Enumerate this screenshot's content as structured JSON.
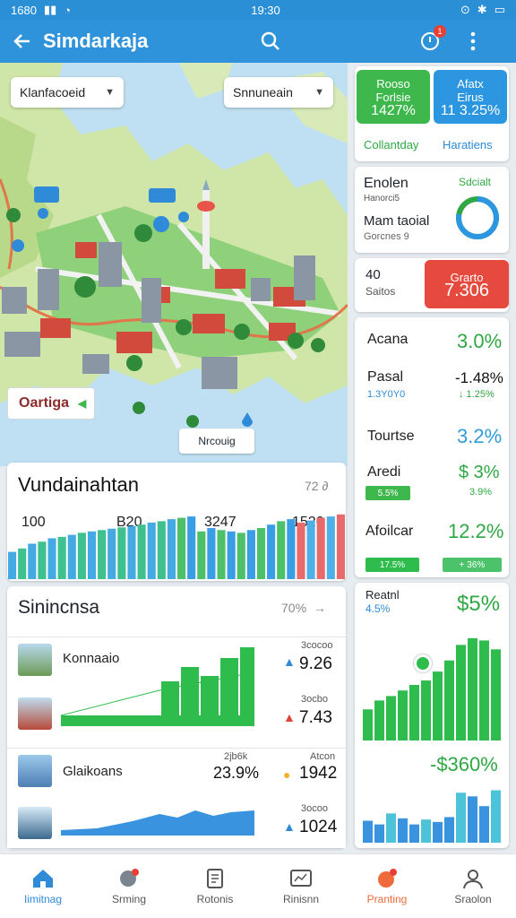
{
  "status": {
    "time_left": "1680",
    "time_center": "19:30"
  },
  "appbar": {
    "title": "Simdarkaja"
  },
  "map": {
    "dropdown_left": "Klanfacoeid",
    "dropdown_right": "Snnuneain",
    "callout_label": "Oartiga",
    "callout_bottom": "Nrcouig"
  },
  "stats": {
    "title": "Vundainahtan",
    "subtitle": "72 ∂",
    "numbers": [
      "100",
      "B20",
      "3247",
      "1520"
    ],
    "bars": [
      0.4,
      0.45,
      0.52,
      0.55,
      0.6,
      0.62,
      0.65,
      0.68,
      0.7,
      0.72,
      0.74,
      0.76,
      0.78,
      0.8,
      0.83,
      0.85,
      0.88,
      0.9,
      0.92,
      0.7,
      0.75,
      0.72,
      0.7,
      0.68,
      0.72,
      0.75,
      0.8,
      0.85,
      0.88,
      0.83,
      0.86,
      0.9,
      0.92,
      0.95
    ]
  },
  "list": {
    "title": "Sinincnsa",
    "subtitle": "70%",
    "rows": [
      {
        "label": "Konnaaio",
        "small": "3cocoo",
        "value": "9.26",
        "arrow": "up",
        "color": "#2f8bd8"
      },
      {
        "label": "",
        "small": "3ocbo",
        "value": "7.43",
        "arrow": "down",
        "color": "#e04436"
      },
      {
        "label": "Glaikoans",
        "small": "2jb6k",
        "value": "1942",
        "pct": "23.9%",
        "arrow": "dot",
        "color": "#f2b233"
      },
      {
        "label": "",
        "small": "3ocoo",
        "value": "1024",
        "arrow": "up",
        "color": "#2f8bd8"
      }
    ]
  },
  "side": {
    "tile1": {
      "l1": "Rooso",
      "l2": "Forlsie",
      "val": "1427%",
      "color": "#3eb84d"
    },
    "tile2": {
      "l1": "Afatx",
      "l2": "Eirus",
      "val": "11 3.25%",
      "color": "#2d96e0"
    },
    "tile1_caption": "Collantday",
    "tile2_caption": "Haratiens",
    "card2": {
      "title": "Enolen",
      "line2": "Hanorci5",
      "line3": "Mam taoial",
      "line4": "Gorcnes 9",
      "small_right": "Sdcialt",
      "ring_pct": 0.78
    },
    "card3": {
      "title": "40",
      "sub": "Saitos",
      "tile_top": "Grarto",
      "tile_val": "7.306"
    },
    "kpis": [
      {
        "label": "Acana",
        "value": "3.0%"
      },
      {
        "label": "Pasal",
        "value": "-1.48%",
        "sub1": "1.3Y0Y0",
        "sub2": "↓ 1.25%"
      },
      {
        "label": "Tourtse",
        "value": "3.2%"
      },
      {
        "label": "Aredi",
        "value": "$ 3%",
        "pill": "5.5%",
        "sub2": "3.9%"
      },
      {
        "label": "Afoilcar",
        "value": "12.2%",
        "pill1": "17.5%",
        "pill2": "+ 36%"
      }
    ],
    "chart_card": {
      "title": "Reatnl",
      "sub": "4.5%",
      "value": "$5%",
      "value2": "-$360%",
      "green_bars": [
        0.28,
        0.36,
        0.4,
        0.45,
        0.5,
        0.54,
        0.62,
        0.72,
        0.86,
        0.92,
        0.9,
        0.82
      ],
      "blue_bars": [
        0.36,
        0.3,
        0.48,
        0.4,
        0.3,
        0.38,
        0.34,
        0.42,
        0.82,
        0.76,
        0.6,
        0.86
      ]
    }
  },
  "nav": {
    "items": [
      "Iimitnag",
      "Srming",
      "Rotonis",
      "Rinisnn",
      "Pranting",
      "Sraolon"
    ]
  }
}
